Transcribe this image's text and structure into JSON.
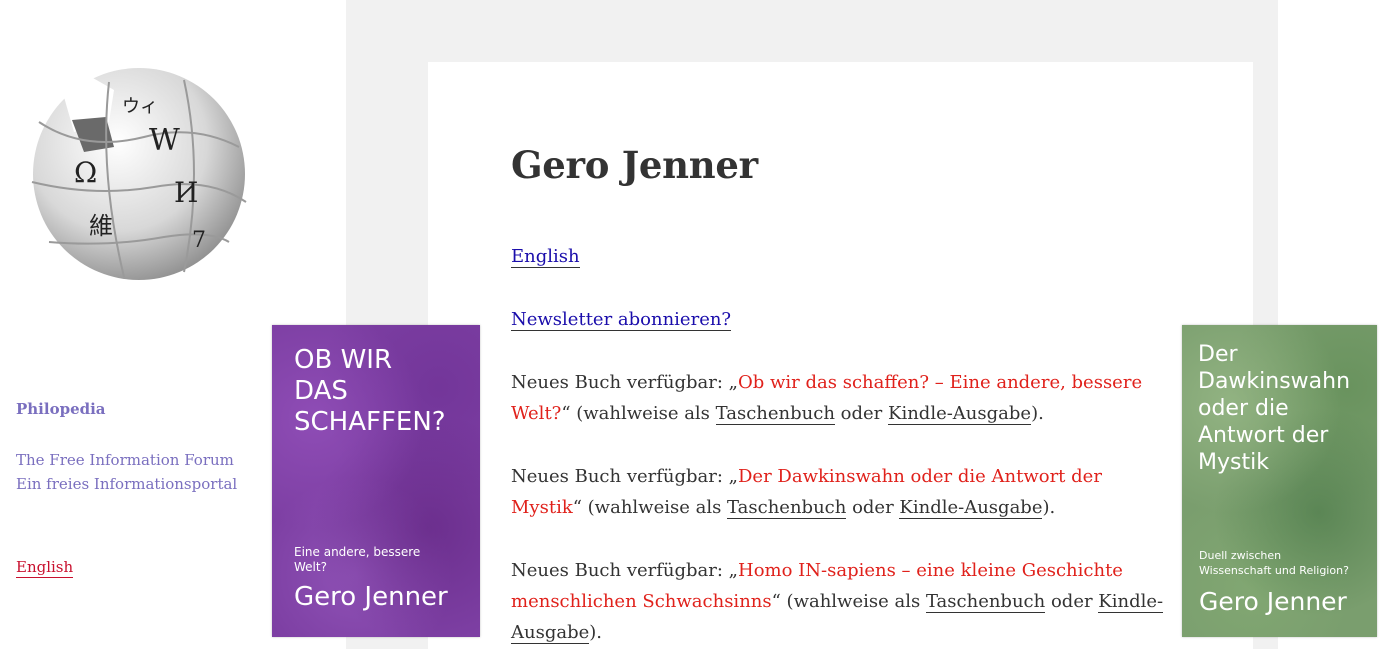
{
  "sidebar": {
    "logo_icon": "wikipedia-puzzle-globe-icon",
    "site_title": "Philopedia",
    "description_lines": [
      "The Free Information Forum",
      "Ein freies Informationsportal"
    ],
    "language_link": "English"
  },
  "main": {
    "title": "Gero Jenner",
    "english_link": "English",
    "newsletter_link": "Newsletter abonnieren?",
    "books": [
      {
        "prefix": "Neues Buch verfügbar: „",
        "title": "Ob wir das schaffen? – Eine andere, bessere Welt?",
        "suffix": "“ (wahlweise als ",
        "paperback": "Taschenbuch",
        "or": " oder ",
        "kindle": "Kindle-Ausgabe",
        "end": ")."
      },
      {
        "prefix": "Neues Buch verfügbar: „",
        "title": "Der Dawkinswahn oder die Antwort der Mystik",
        "suffix": "“ (wahlweise als ",
        "paperback": "Taschenbuch",
        "or": " oder ",
        "kindle": "Kindle-Ausgabe",
        "end": ")."
      },
      {
        "prefix": "Neues Buch verfügbar: „",
        "title": "Homo IN-sapiens – eine kleine Geschichte menschlichen Schwachsinns",
        "suffix": "“ (wahlweise als ",
        "paperback": "Taschenbuch",
        "or": " oder ",
        "kindle": "Kindle-Ausgabe",
        "end": ")."
      }
    ]
  },
  "covers": {
    "left": {
      "title": "OB WIR\nDAS\nSCHAFFEN?",
      "subtitle": "Eine andere, bessere\nWelt?",
      "author": "Gero Jenner",
      "color": "#7d3fa3"
    },
    "right": {
      "title": "Der\nDawkinswahn\noder die\nAntwort der\nMystik",
      "subtitle": "Duell zwischen\nWissenschaft und Religion?",
      "author": "Gero Jenner",
      "color": "#7a9e6e"
    }
  },
  "colors": {
    "link_blue": "#1a0dab",
    "book_title_red": "#e0211b",
    "sidebar_purple": "#7a6fbf",
    "sidebar_red": "#c8102e",
    "content_background": "#f1f1f1"
  }
}
